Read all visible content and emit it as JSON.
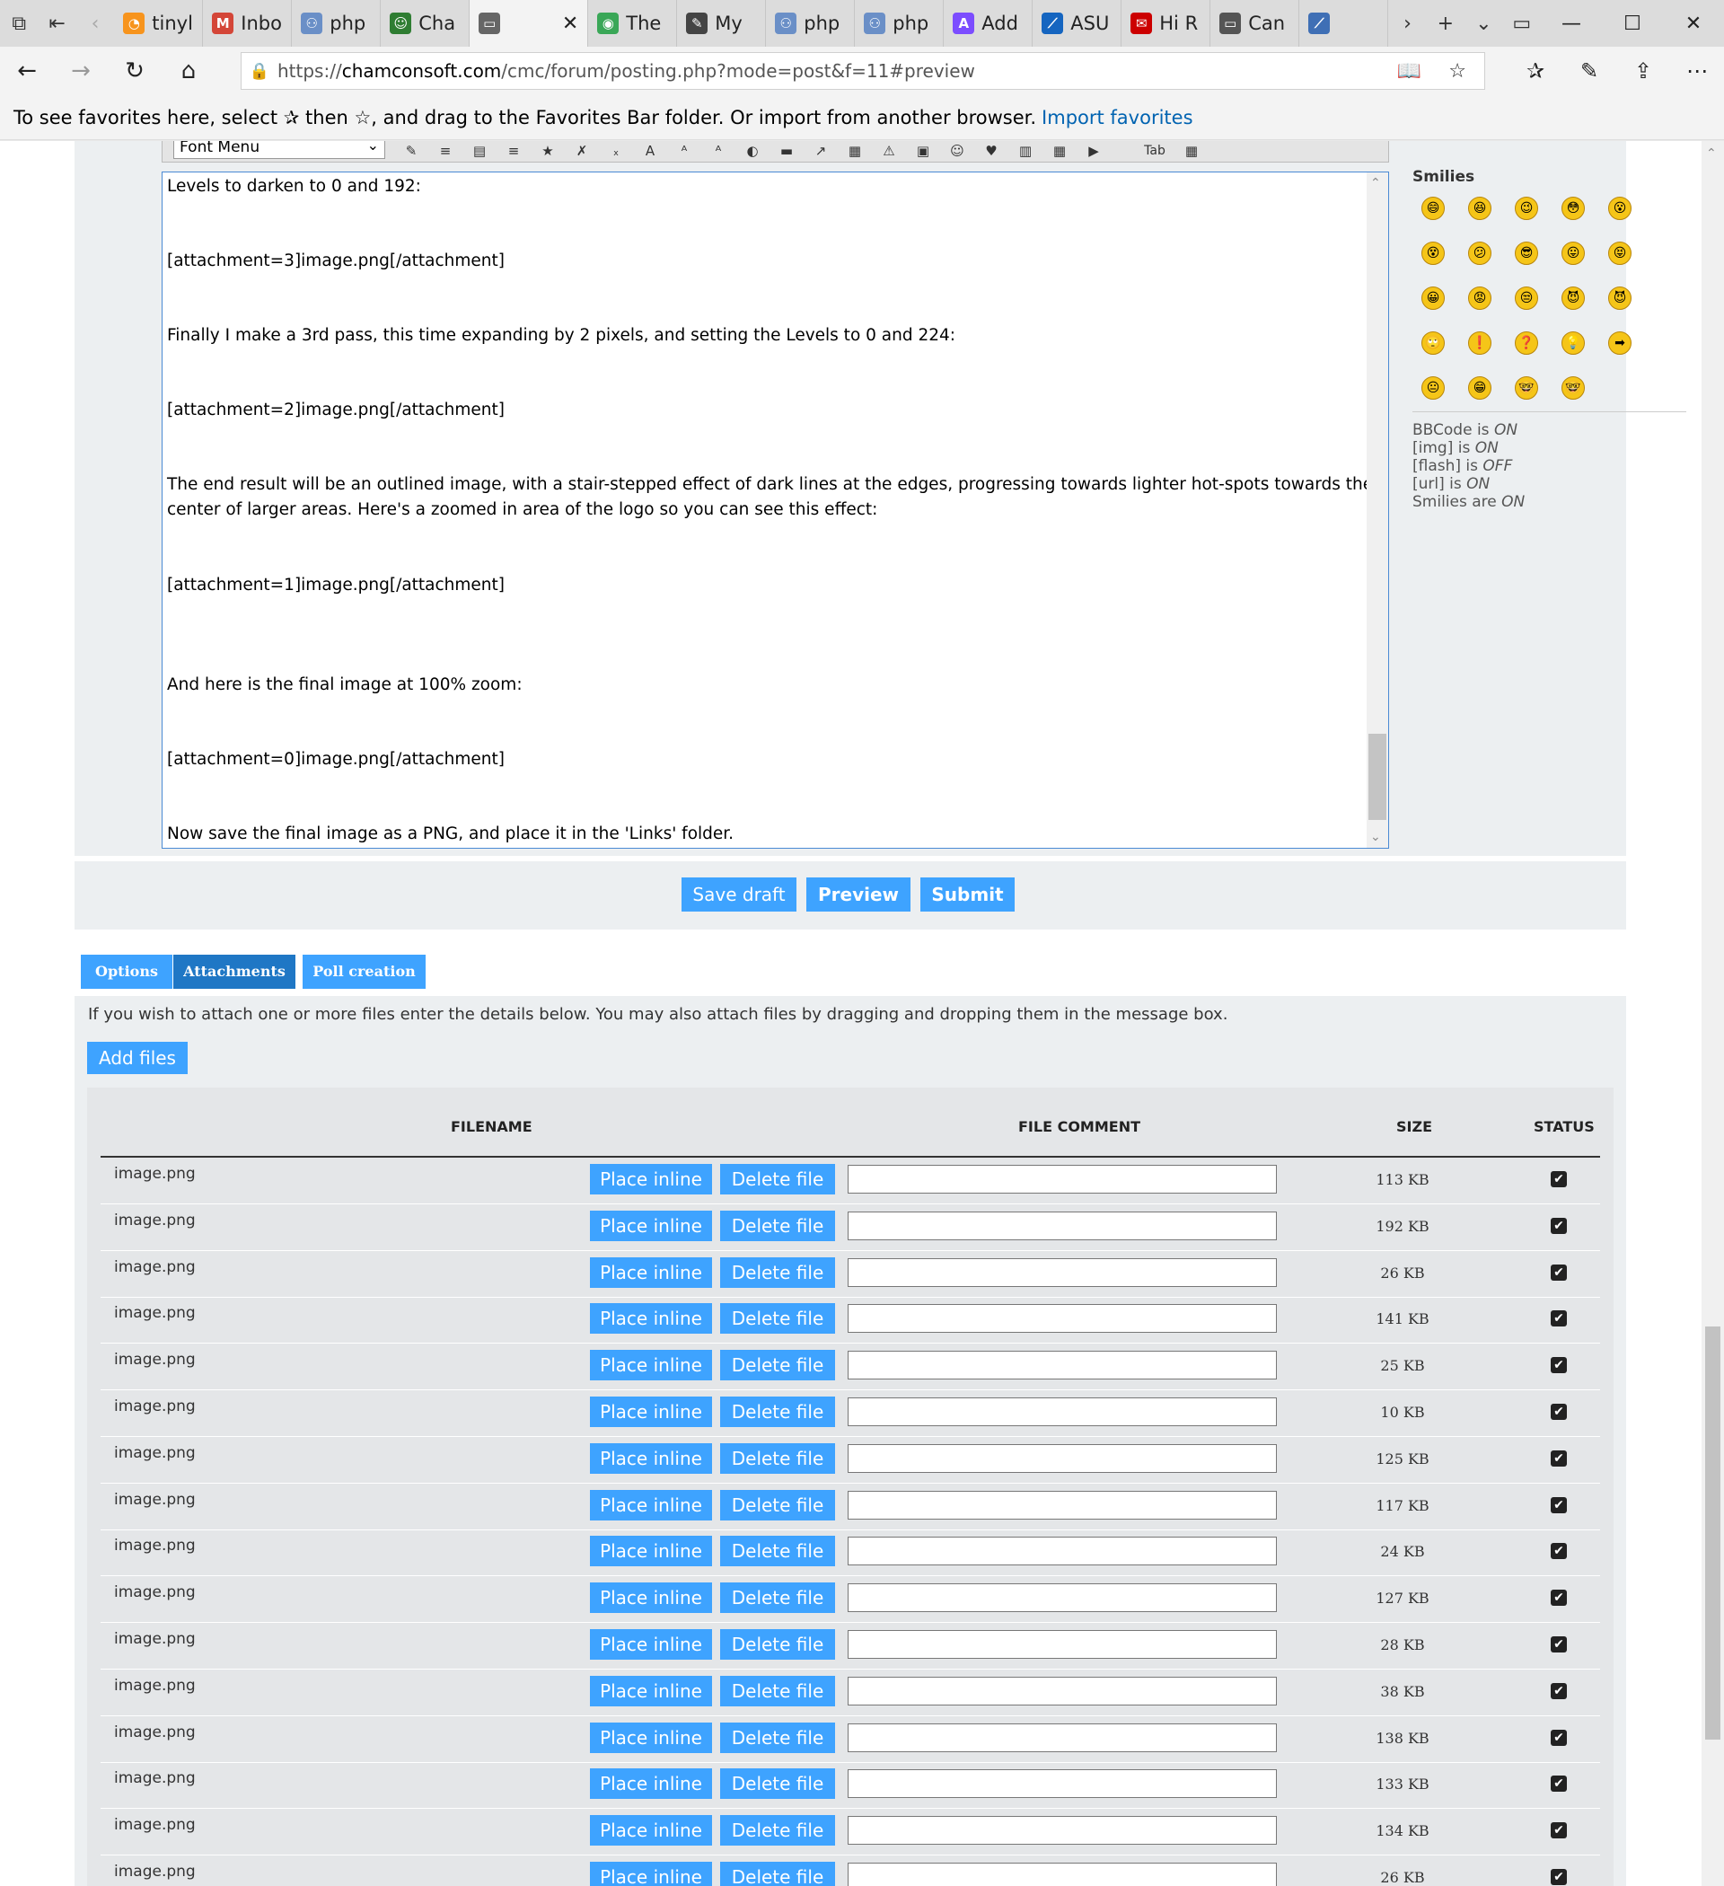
{
  "browser": {
    "tabs": [
      {
        "title": "tinyl",
        "color": "#f7941d",
        "glyph": "◔"
      },
      {
        "title": "Inbo",
        "color": "#d44638",
        "glyph": "M"
      },
      {
        "title": "php",
        "color": "#6a8fc7",
        "glyph": "⚇"
      },
      {
        "title": "Cha",
        "color": "#2f7d32",
        "glyph": "☺"
      },
      {
        "title": "",
        "color": "#666666",
        "glyph": "▭",
        "active": true
      },
      {
        "title": "The",
        "color": "#3aa757",
        "glyph": "◉"
      },
      {
        "title": "My",
        "color": "#444444",
        "glyph": "✎"
      },
      {
        "title": "php",
        "color": "#6a8fc7",
        "glyph": "⚇"
      },
      {
        "title": "php",
        "color": "#6a8fc7",
        "glyph": "⚇"
      },
      {
        "title": "Add",
        "color": "#7c4dff",
        "glyph": "A"
      },
      {
        "title": "ASU",
        "color": "#1565c0",
        "glyph": "⟋"
      },
      {
        "title": "Hi R",
        "color": "#cc0000",
        "glyph": "✉"
      },
      {
        "title": "Can",
        "color": "#555555",
        "glyph": "▭"
      },
      {
        "title": "",
        "color": "#3f6fb5",
        "glyph": "⟋"
      }
    ],
    "url_prefix": "https://",
    "url_host": "chamconsoft.com",
    "url_path": "/cmc/forum/posting.php?mode=post&f=11#preview",
    "fav_message": "To see favorites here, select ✰ then ☆, and drag to the Favorites Bar folder. Or import from another browser.",
    "fav_link": "Import favorites"
  },
  "editor": {
    "font_menu": "Font Menu",
    "tab_label": "Tab",
    "lines": [
      "Levels to darken to 0 and 192:",
      "[attachment=3]image.png[/attachment]",
      "Finally I make a 3rd pass, this time expanding by 2 pixels, and setting the Levels to 0 and 224:",
      "[attachment=2]image.png[/attachment]",
      "The end result will be an outlined image, with a stair-stepped effect of dark lines at the edges, progressing towards lighter hot-spots towards the",
      "center of larger areas.  Here's a zoomed in area of the logo so you can see this effect:",
      "[attachment=1]image.png[/attachment]",
      "And here is the final image at 100% zoom:",
      "[attachment=0]image.png[/attachment]",
      "Now save the final image as a PNG, and place it in the 'Links' folder."
    ]
  },
  "smilies": {
    "title": "Smilies",
    "icons": [
      "😄",
      "😆",
      "😉",
      "😳",
      "😮",
      "😵",
      "😕",
      "😎",
      "😛",
      "😝",
      "😀",
      "😡",
      "😒",
      "😈",
      "😈",
      "🙄",
      "❗",
      "❓",
      "💡",
      "➡",
      "😐",
      "😁",
      "🤓",
      "🤓"
    ],
    "status": [
      {
        "label": "BBCode is ",
        "value": "ON"
      },
      {
        "label": "[img] is ",
        "value": "ON"
      },
      {
        "label": "[flash] is ",
        "value": "OFF"
      },
      {
        "label": "[url] is ",
        "value": "ON"
      },
      {
        "label": "Smilies are ",
        "value": "ON"
      }
    ]
  },
  "actions": {
    "save_draft": "Save draft",
    "preview": "Preview",
    "submit": "Submit"
  },
  "panel_tabs": [
    "Options",
    "Attachments",
    "Poll creation"
  ],
  "attachments": {
    "help": "If you wish to attach one or more files enter the details below. You may also attach files by dragging and dropping them in the message box.",
    "add_files": "Add files",
    "columns": [
      "FILENAME",
      "FILE COMMENT",
      "SIZE",
      "STATUS"
    ],
    "place_inline": "Place inline",
    "delete_file": "Delete file",
    "files": [
      {
        "name": "image.png",
        "size": "113 KB"
      },
      {
        "name": "image.png",
        "size": "192 KB"
      },
      {
        "name": "image.png",
        "size": "26 KB"
      },
      {
        "name": "image.png",
        "size": "141 KB"
      },
      {
        "name": "image.png",
        "size": "25 KB"
      },
      {
        "name": "image.png",
        "size": "10 KB"
      },
      {
        "name": "image.png",
        "size": "125 KB"
      },
      {
        "name": "image.png",
        "size": "117 KB"
      },
      {
        "name": "image.png",
        "size": "24 KB"
      },
      {
        "name": "image.png",
        "size": "127 KB"
      },
      {
        "name": "image.png",
        "size": "28 KB"
      },
      {
        "name": "image.png",
        "size": "38 KB"
      },
      {
        "name": "image.png",
        "size": "138 KB"
      },
      {
        "name": "image.png",
        "size": "133 KB"
      },
      {
        "name": "image.png",
        "size": "134 KB"
      },
      {
        "name": "image.png",
        "size": "26 KB"
      }
    ]
  }
}
